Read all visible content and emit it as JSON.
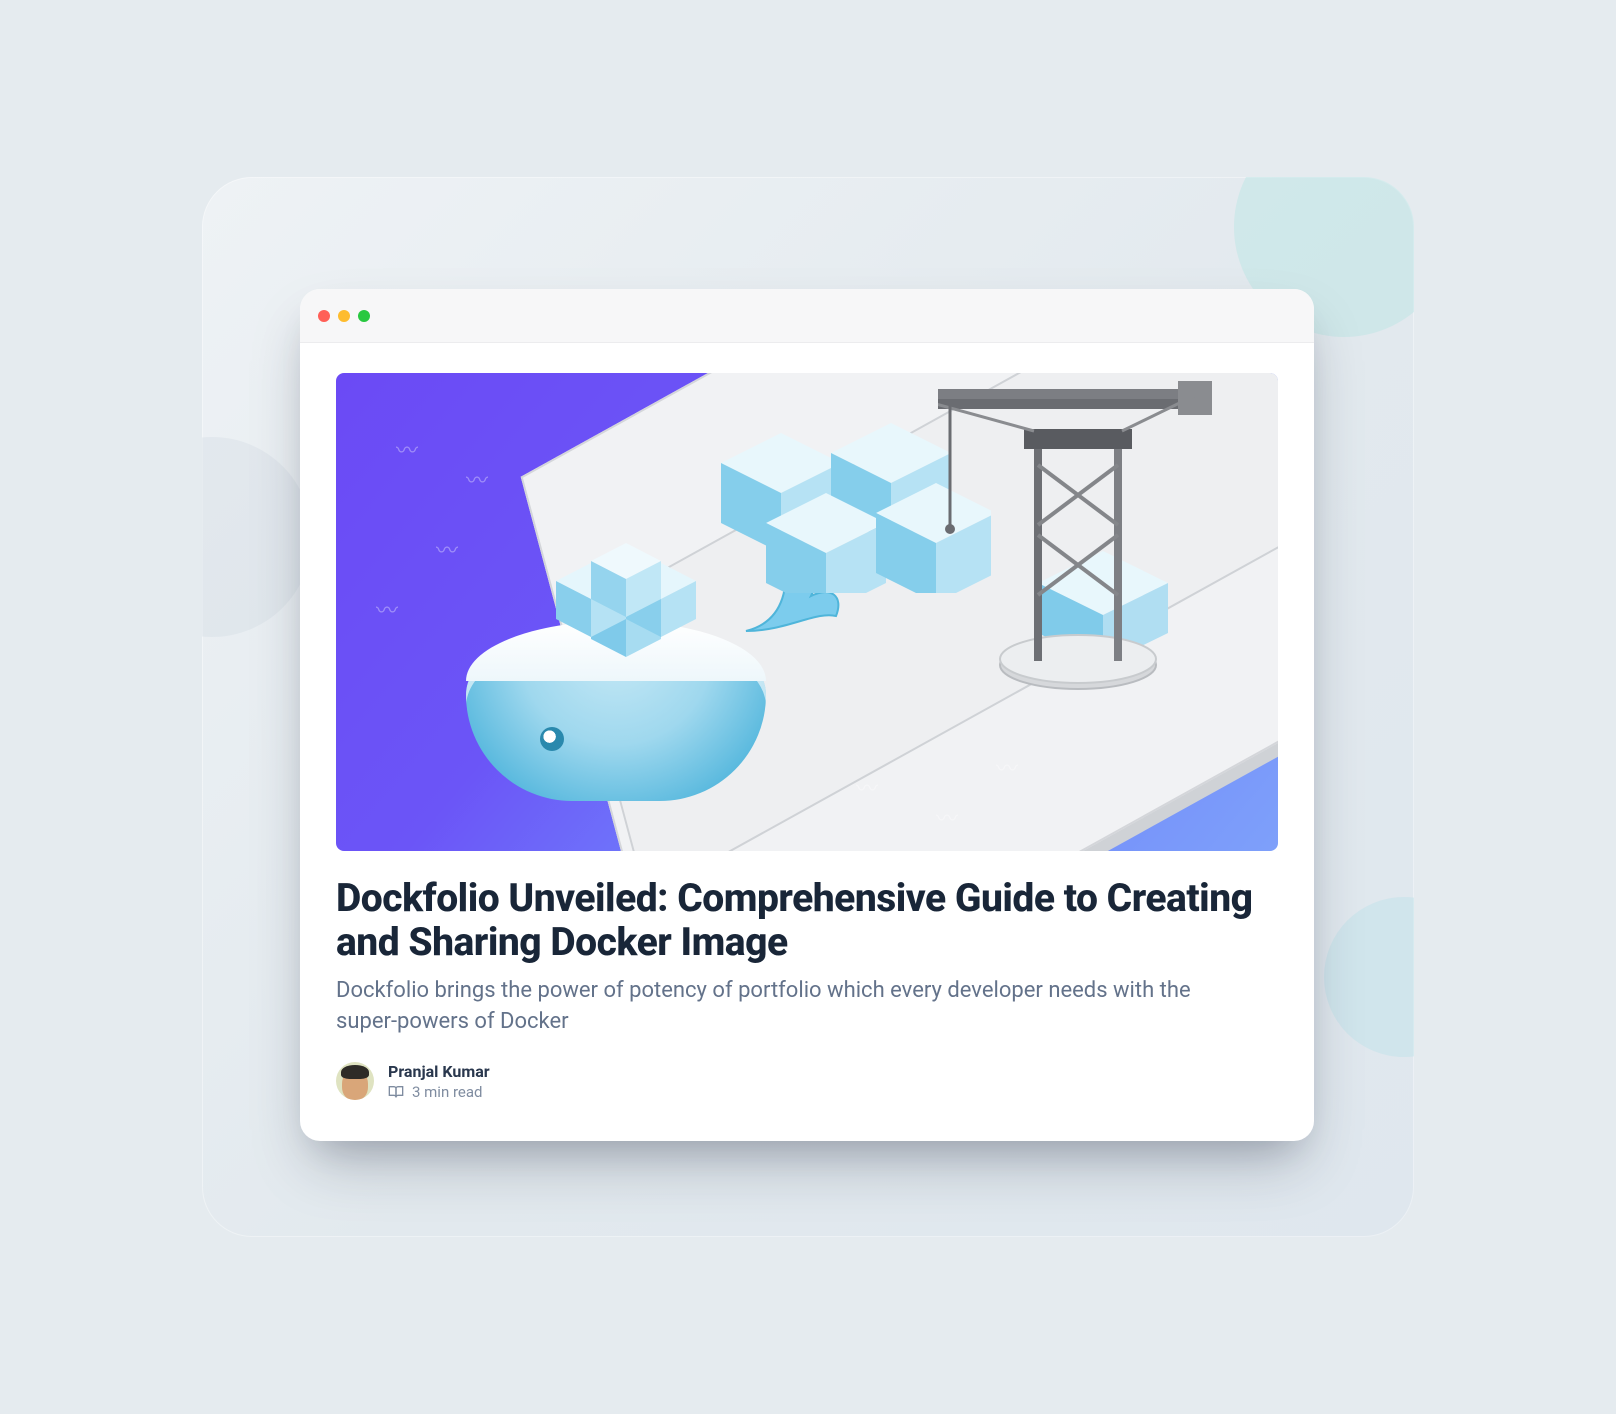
{
  "article": {
    "title": "Dockfolio Unveiled: Comprehensive Guide to Creating and Sharing Docker Image",
    "subtitle": "Dockfolio brings the power of potency of portfolio which every developer needs with the super-powers of Docker",
    "author": "Pranjal Kumar",
    "read_time": "3 min read"
  },
  "hero": {
    "alt": "Isometric docker whale carrying containers beside a shipping dock with a crane",
    "colors": {
      "water_start": "#6b4af5",
      "water_end": "#7ea0fa",
      "container_light": "#d7f1fb",
      "container_dark": "#7cc9ea",
      "crane": "#707277",
      "dock": "#f1f2f4"
    }
  },
  "window": {
    "traffic_lights": [
      "close",
      "minimize",
      "maximize"
    ]
  }
}
